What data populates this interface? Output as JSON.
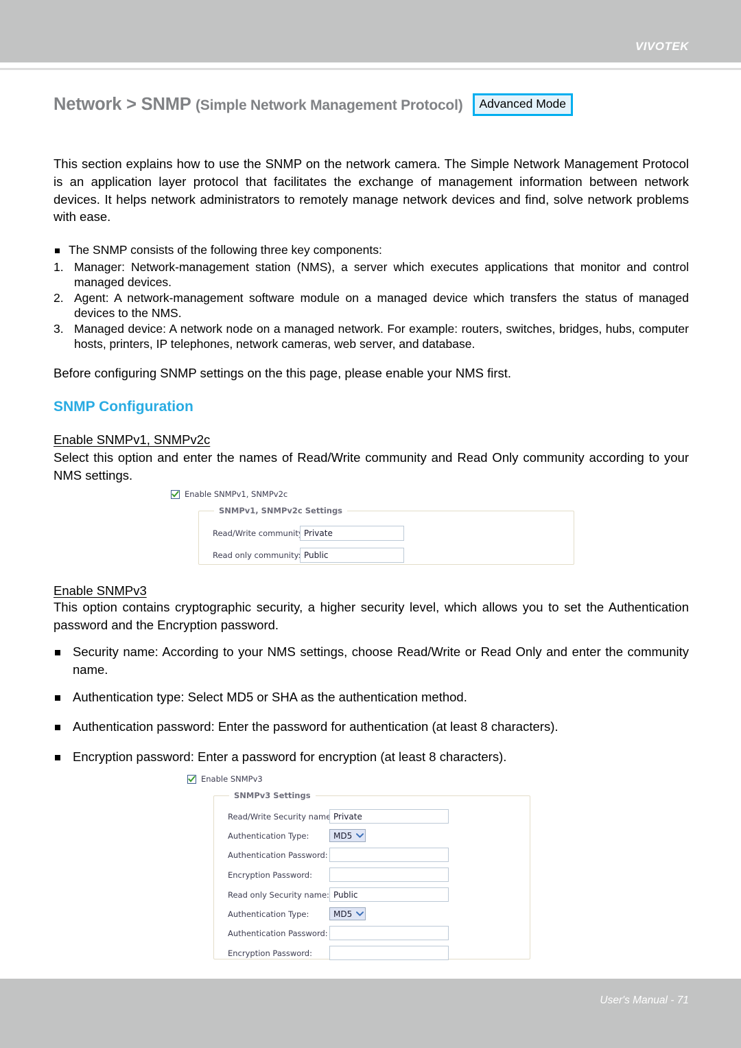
{
  "header": {
    "brand": "VIVOTEK"
  },
  "title": {
    "main": "Network > SNMP ",
    "sub": "(Simple Network Management Protocol)",
    "badge": "Advanced Mode"
  },
  "intro": "This section explains how to use the SNMP on the network camera. The Simple Network Management Protocol is an application layer protocol that facilitates the exchange of management information between network devices. It helps network administrators to remotely manage network devices and find, solve network problems with ease.",
  "components": {
    "lead": "The SNMP consists of the following three key components:",
    "items": [
      {
        "num": "1.",
        "text": "Manager: Network-management station (NMS), a server which executes applications that monitor and control managed devices."
      },
      {
        "num": "2.",
        "text": "Agent: A network-management software module on a managed device which transfers the status of managed devices to the NMS."
      },
      {
        "num": "3.",
        "text": "Managed device: A network node on a managed network. For example: routers, switches, bridges, hubs, computer hosts, printers, IP telephones, network cameras, web server, and database."
      }
    ]
  },
  "before_note": "Before configuring SNMP settings on the this page, please enable your NMS first.",
  "section_heading": "SNMP Configuration",
  "snmpv1": {
    "heading": "Enable SNMPv1, SNMPv2c",
    "description": "Select this option and enter the names of Read/Write community and Read Only community according to your NMS settings.",
    "screenshot": {
      "checkbox_label": "Enable SNMPv1, SNMPv2c",
      "checkbox_checked": true,
      "legend": "SNMPv1, SNMPv2c Settings",
      "fields": [
        {
          "label": "Read/Write community:",
          "value": "Private"
        },
        {
          "label": "Read only community:",
          "value": "Public"
        }
      ]
    }
  },
  "snmpv3": {
    "heading": "Enable SNMPv3",
    "description": "This option contains cryptographic security, a higher security level, which allows you to set the Authentication password and the Encryption password.",
    "bullets": [
      "Security name: According to your NMS settings, choose Read/Write or Read Only and enter the community name.",
      "Authentication type: Select MD5 or SHA as the authentication method.",
      "Authentication password: Enter the password for authentication (at least 8 characters).",
      "Encryption password: Enter a password for encryption (at least 8 characters)."
    ],
    "screenshot": {
      "checkbox_label": "Enable SNMPv3",
      "checkbox_checked": true,
      "legend": "SNMPv3 Settings",
      "fields": [
        {
          "label": "Read/Write Security name:",
          "value": "Private",
          "type": "text"
        },
        {
          "label": "Authentication Type:",
          "value": "MD5",
          "type": "select"
        },
        {
          "label": "Authentication Password:",
          "value": "",
          "type": "text"
        },
        {
          "label": "Encryption Password:",
          "value": "",
          "type": "text"
        },
        {
          "label": "Read only Security name:",
          "value": "Public",
          "type": "text"
        },
        {
          "label": "Authentication Type:",
          "value": "MD5",
          "type": "select"
        },
        {
          "label": "Authentication Password:",
          "value": "",
          "type": "text"
        },
        {
          "label": "Encryption Password:",
          "value": "",
          "type": "text"
        }
      ]
    }
  },
  "footer": {
    "text": "User's Manual - 71"
  },
  "colors": {
    "band": "#c2c3c3",
    "accent_blue": "#29abe2",
    "badge_border": "#00aeef",
    "badge_fill": "#e4f3fb",
    "title_gray": "#808285",
    "check_green": "#3a9b2f"
  }
}
